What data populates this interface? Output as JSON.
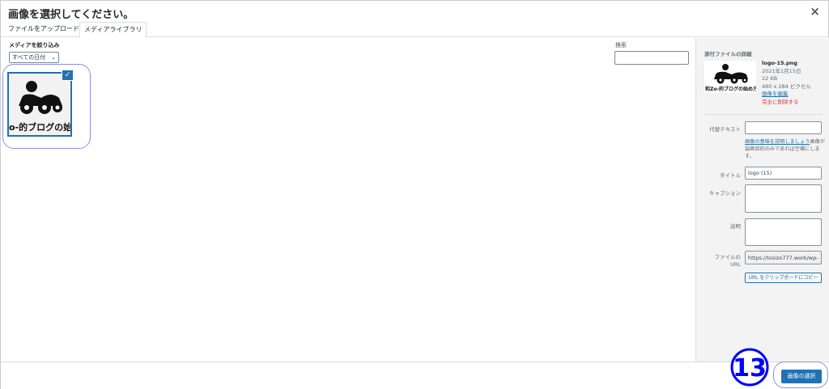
{
  "modal": {
    "title": "画像を選択してください。",
    "close_glyph": "×"
  },
  "tabs": [
    {
      "label": "ファイルをアップロード"
    },
    {
      "label": "メディアライブラリ"
    }
  ],
  "filter": {
    "label": "メディアを絞り込み",
    "selected": "すべての日付",
    "chevron": "⌄"
  },
  "search": {
    "label": "検索",
    "value": ""
  },
  "attachment": {
    "thumb_text": "o-的ブログの始",
    "check_glyph": "✓"
  },
  "details": {
    "heading": "添付ファイルの詳細",
    "thumb_text": "和Zo-的ブログの始め方",
    "filename": "logo-15.png",
    "date": "2021年1月15日",
    "size": "22 KB",
    "dimensions": "480 x 284 ピクセル",
    "edit_link": "画像を編集",
    "delete_link": "完全に削除する"
  },
  "fields": {
    "alt_label": "代替テキスト",
    "alt_value": "",
    "alt_help_link": "画像の意味を説明しましょう",
    "alt_help_text": "画像が装飾目的のみであれば空欄にします。",
    "title_label": "タイトル",
    "title_value": "logo (15)",
    "caption_label": "キャプション",
    "caption_value": "",
    "description_label": "説明",
    "description_value": "",
    "url_label_1": "ファイルの",
    "url_label_2": "URL",
    "url_value": "https://tosizo777.work/wp-",
    "copy_button": "URL をクリップボードにコピー"
  },
  "footer": {
    "select_button": "画像の選択",
    "step_number": "13"
  },
  "colors": {
    "accent": "#2271b1",
    "danger": "#d63638",
    "highlight": "#8d8df0",
    "step_number": "#0000ff"
  }
}
